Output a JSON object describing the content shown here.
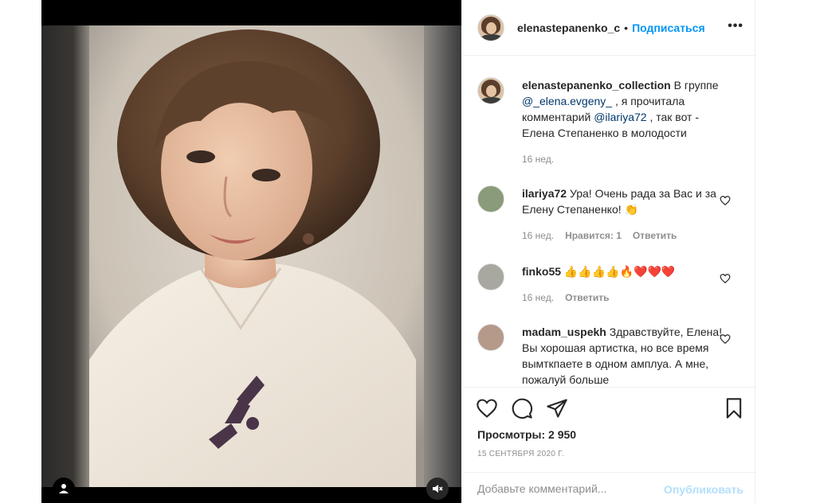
{
  "header": {
    "username": "elenastepanenko_c",
    "separator": "•",
    "follow_label": "Подписаться",
    "more_icon": "more-horizontal-icon",
    "more_label": "•••"
  },
  "caption": {
    "username": "elenastepanenko_collection",
    "text_1": " В группе ",
    "mention_1": "@_elena.evgeny_",
    "text_2": " , я прочитала комментарий ",
    "mention_2": "@ilariya72",
    "text_3": " , так вот - Елена Степаненко в молодости",
    "time": "16 нед."
  },
  "comments": [
    {
      "username": "ilariya72",
      "text": " Ура! Очень рада за Вас и за Елену Степаненко! 👏",
      "time": "16 нед.",
      "likes": "Нравится: 1",
      "reply": "Ответить"
    },
    {
      "username": "finko55",
      "text": " 👍👍👍👍🔥❤️❤️❤️",
      "time": "16 нед.",
      "reply": "Ответить"
    },
    {
      "username": "madam_uspekh",
      "text": " Здравствуйте, Елена! Вы хорошая артистка, но все время вымткпаете в одном амплуа. А мне, пожалуй больше"
    }
  ],
  "actions": {
    "like_icon": "heart-icon",
    "comment_icon": "comment-bubble-icon",
    "share_icon": "paper-plane-icon",
    "save_icon": "bookmark-icon"
  },
  "stats": {
    "views": "Просмотры: 2 950",
    "date": "15 СЕНТЯБРЯ 2020 Г."
  },
  "add_comment": {
    "placeholder": "Добавьте комментарий...",
    "publish_label": "Опубликовать"
  },
  "colors": {
    "link": "#0095f6",
    "muted": "#8e8e8e",
    "text": "#262626",
    "publish_disabled": "#b2dffc"
  }
}
